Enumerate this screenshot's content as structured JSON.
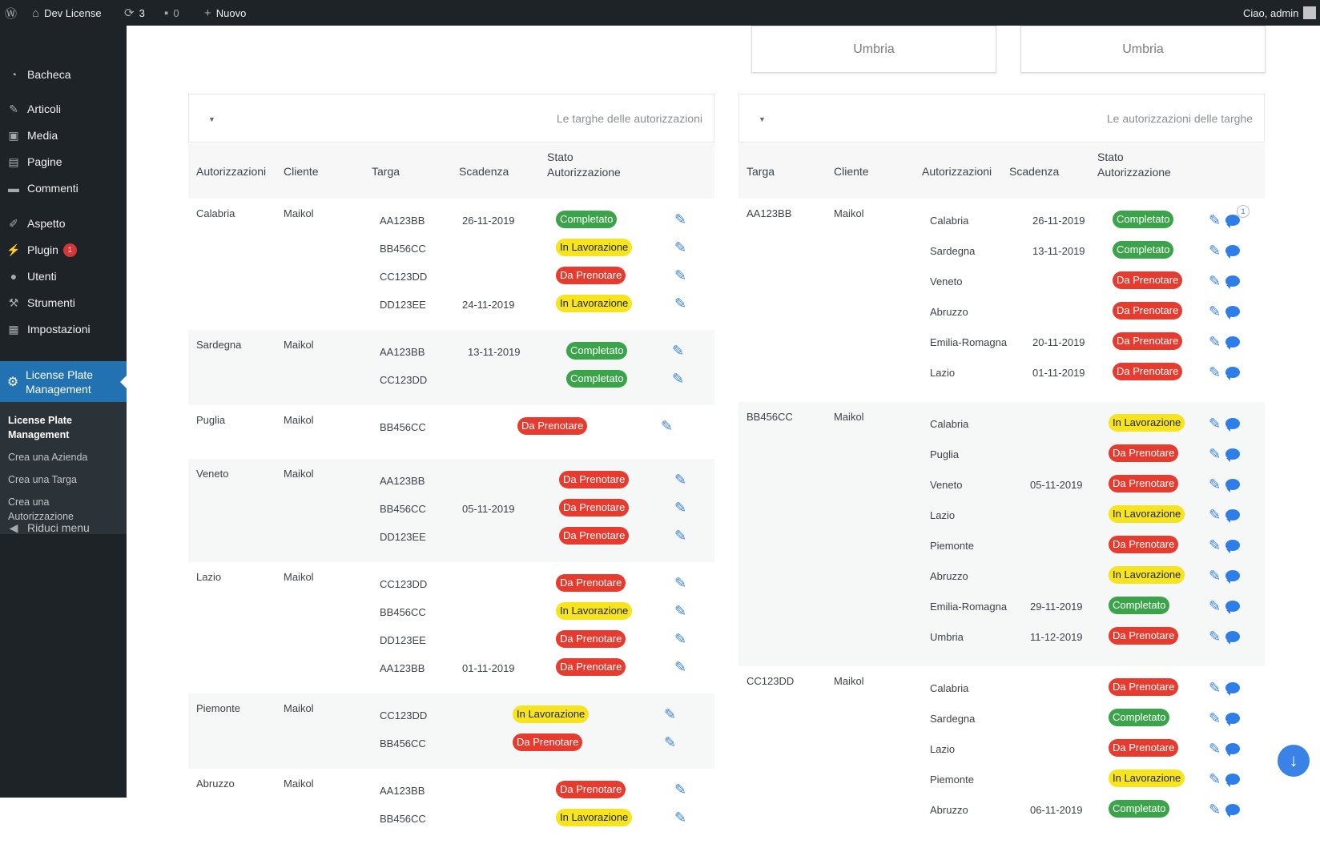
{
  "adminbar": {
    "site_name": "Dev License",
    "updates_count": "3",
    "comments_count": "0",
    "new_label": "Nuovo",
    "greeting": "Ciao, admin"
  },
  "sidebar": {
    "items": [
      {
        "label": "Bacheca",
        "icon": "dashboard-icon"
      },
      {
        "label": "Articoli",
        "icon": "pin-icon"
      },
      {
        "label": "Media",
        "icon": "media-icon"
      },
      {
        "label": "Pagine",
        "icon": "pages-icon"
      },
      {
        "label": "Commenti",
        "icon": "comments-icon"
      },
      {
        "label": "Aspetto",
        "icon": "appearance-icon"
      },
      {
        "label": "Plugin",
        "icon": "plugin-icon",
        "badge": "1"
      },
      {
        "label": "Utenti",
        "icon": "users-icon"
      },
      {
        "label": "Strumenti",
        "icon": "tools-icon"
      },
      {
        "label": "Impostazioni",
        "icon": "settings-icon"
      }
    ],
    "active": {
      "label": "License Plate Management",
      "icon": "gear-icon"
    },
    "submenu": [
      "License Plate Management",
      "Crea una Azienda",
      "Crea una Targa",
      "Crea una Autorizzazione"
    ],
    "collapse_label": "Riduci menu"
  },
  "top_cards": [
    "Umbria",
    "Umbria"
  ],
  "left_panel": {
    "title": "Le targhe delle autorizzazioni",
    "headers": [
      "Autorizzazioni",
      "Cliente",
      "Targa",
      "Scadenza",
      "Stato Autorizzazione"
    ],
    "groups": [
      {
        "name": "Calabria",
        "client": "Maikol",
        "rows": [
          {
            "plate": "AA123BB",
            "date": "26-11-2019",
            "status": "Completato"
          },
          {
            "plate": "BB456CC",
            "date": "",
            "status": "In Lavorazione"
          },
          {
            "plate": "CC123DD",
            "date": "",
            "status": "Da Prenotare"
          },
          {
            "plate": "DD123EE",
            "date": "24-11-2019",
            "status": "In Lavorazione"
          }
        ]
      },
      {
        "name": "Sardegna",
        "client": "Maikol",
        "rows": [
          {
            "plate": "AA123BB",
            "date": "13-11-2019",
            "status": "Completato"
          },
          {
            "plate": "CC123DD",
            "date": "",
            "status": "Completato"
          }
        ]
      },
      {
        "name": "Puglia",
        "client": "Maikol",
        "rows": [
          {
            "plate": "BB456CC",
            "date": "",
            "status": "Da Prenotare"
          }
        ]
      },
      {
        "name": "Veneto",
        "client": "Maikol",
        "rows": [
          {
            "plate": "AA123BB",
            "date": "",
            "status": "Da Prenotare"
          },
          {
            "plate": "BB456CC",
            "date": "05-11-2019",
            "status": "Da Prenotare"
          },
          {
            "plate": "DD123EE",
            "date": "",
            "status": "Da Prenotare"
          }
        ]
      },
      {
        "name": "Lazio",
        "client": "Maikol",
        "rows": [
          {
            "plate": "CC123DD",
            "date": "",
            "status": "Da Prenotare"
          },
          {
            "plate": "BB456CC",
            "date": "",
            "status": "In Lavorazione"
          },
          {
            "plate": "DD123EE",
            "date": "",
            "status": "Da Prenotare"
          },
          {
            "plate": "AA123BB",
            "date": "01-11-2019",
            "status": "Da Prenotare"
          }
        ]
      },
      {
        "name": "Piemonte",
        "client": "Maikol",
        "rows": [
          {
            "plate": "CC123DD",
            "date": "",
            "status": "In Lavorazione"
          },
          {
            "plate": "BB456CC",
            "date": "",
            "status": "Da Prenotare"
          }
        ]
      },
      {
        "name": "Abruzzo",
        "client": "Maikol",
        "rows": [
          {
            "plate": "AA123BB",
            "date": "",
            "status": "Da Prenotare"
          },
          {
            "plate": "BB456CC",
            "date": "",
            "status": "In Lavorazione"
          }
        ]
      }
    ]
  },
  "right_panel": {
    "title": "Le autorizzazioni delle targhe",
    "headers": [
      "Targa",
      "Cliente",
      "Autorizzazioni",
      "Scadenza",
      "Stato Autorizzazione"
    ],
    "first_row_comment_count": "1",
    "groups": [
      {
        "name": "AA123BB",
        "client": "Maikol",
        "rows": [
          {
            "auth": "Calabria",
            "date": "26-11-2019",
            "status": "Completato"
          },
          {
            "auth": "Sardegna",
            "date": "13-11-2019",
            "status": "Completato"
          },
          {
            "auth": "Veneto",
            "date": "",
            "status": "Da Prenotare"
          },
          {
            "auth": "Abruzzo",
            "date": "",
            "status": "Da Prenotare"
          },
          {
            "auth": "Emilia-Romagna",
            "date": "20-11-2019",
            "status": "Da Prenotare"
          },
          {
            "auth": "Lazio",
            "date": "01-11-2019",
            "status": "Da Prenotare"
          }
        ]
      },
      {
        "name": "BB456CC",
        "client": "Maikol",
        "rows": [
          {
            "auth": "Calabria",
            "date": "",
            "status": "In Lavorazione"
          },
          {
            "auth": "Puglia",
            "date": "",
            "status": "Da Prenotare"
          },
          {
            "auth": "Veneto",
            "date": "05-11-2019",
            "status": "Da Prenotare"
          },
          {
            "auth": "Lazio",
            "date": "",
            "status": "In Lavorazione"
          },
          {
            "auth": "Piemonte",
            "date": "",
            "status": "Da Prenotare"
          },
          {
            "auth": "Abruzzo",
            "date": "",
            "status": "In Lavorazione"
          },
          {
            "auth": "Emilia-Romagna",
            "date": "29-11-2019",
            "status": "Completato"
          },
          {
            "auth": "Umbria",
            "date": "11-12-2019",
            "status": "Da Prenotare"
          }
        ]
      },
      {
        "name": "CC123DD",
        "client": "Maikol",
        "rows": [
          {
            "auth": "Calabria",
            "date": "",
            "status": "Da Prenotare"
          },
          {
            "auth": "Sardegna",
            "date": "",
            "status": "Completato"
          },
          {
            "auth": "Lazio",
            "date": "",
            "status": "Da Prenotare"
          },
          {
            "auth": "Piemonte",
            "date": "",
            "status": "In Lavorazione"
          },
          {
            "auth": "Abruzzo",
            "date": "06-11-2019",
            "status": "Completato"
          }
        ]
      }
    ]
  },
  "status_colors": {
    "Completato": "#3ba44a",
    "In Lavorazione": "#f7e41e",
    "Da Prenotare": "#e63b2e"
  }
}
